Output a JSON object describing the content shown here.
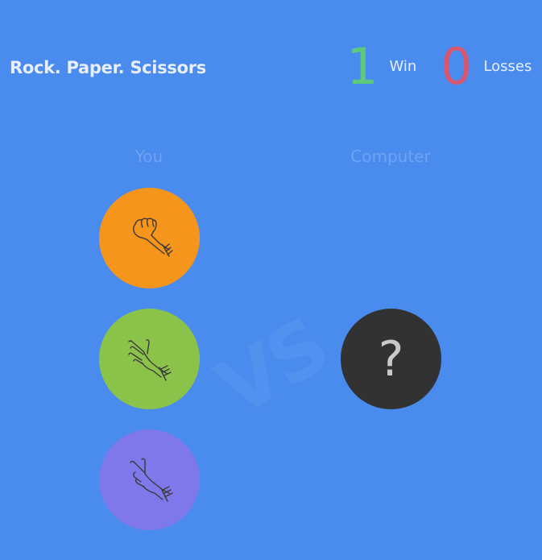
{
  "header": {
    "title": "Rock. Paper. Scissors"
  },
  "score": {
    "wins": "1",
    "wins_label": "Win",
    "losses": "0",
    "losses_label": "Losses"
  },
  "columns": {
    "you": "You",
    "computer": "Computer"
  },
  "vs_text": "VS",
  "choices": [
    {
      "name": "rock",
      "icon": "fist-icon",
      "color": "#f6951c"
    },
    {
      "name": "paper",
      "icon": "open-hand-icon",
      "color": "#8bc34a"
    },
    {
      "name": "scissors",
      "icon": "peace-hand-icon",
      "color": "#7e78ea"
    }
  ],
  "computer": {
    "placeholder": "?",
    "color": "#323232"
  },
  "colors": {
    "background": "#4a8bee",
    "win": "#5ec97a",
    "loss": "#d8566e"
  }
}
